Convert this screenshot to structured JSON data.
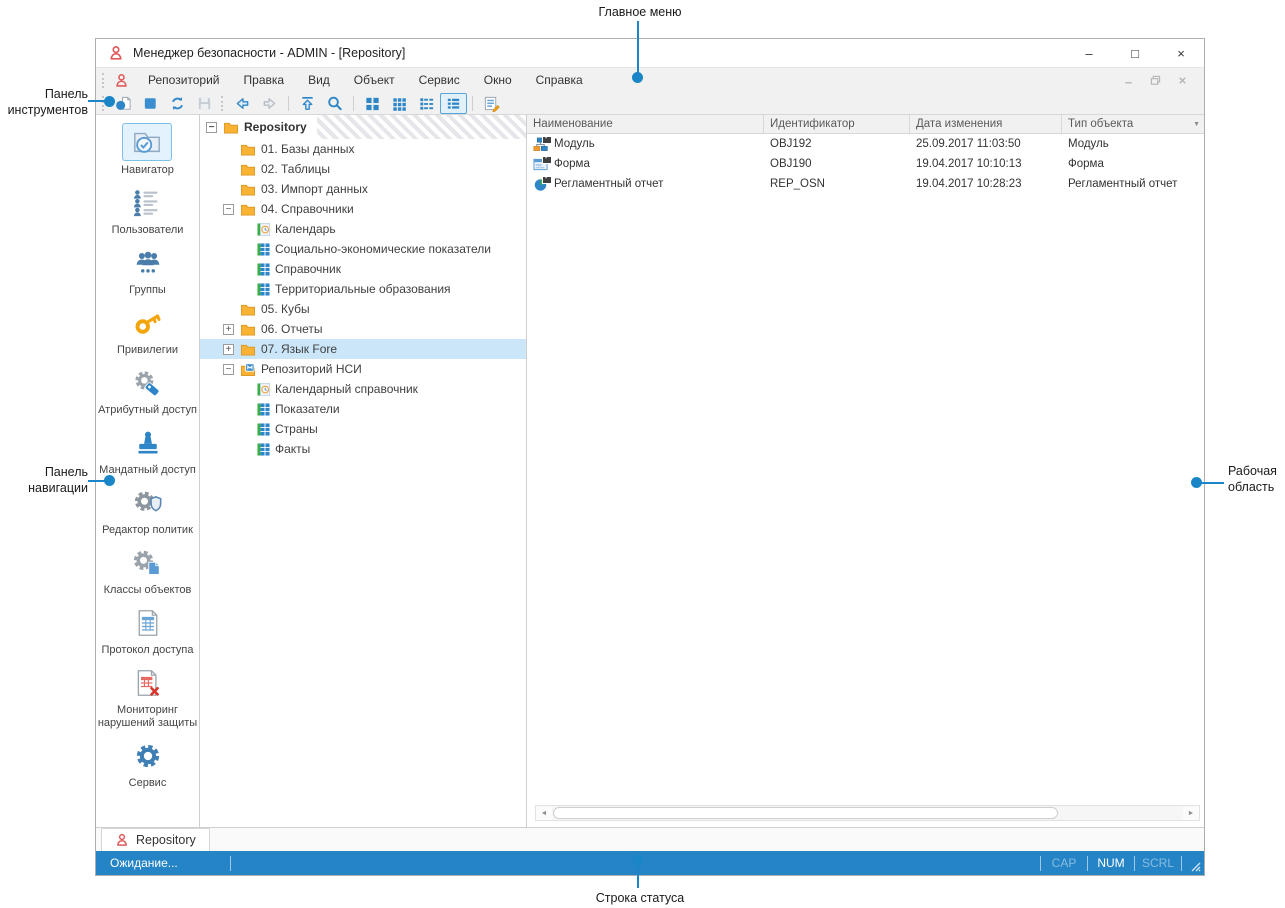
{
  "annotations": {
    "main_menu": "Главное меню",
    "toolbar_panel": "Панель инструментов",
    "navigation_panel": "Панель навигации",
    "work_area": "Рабочая область",
    "status_bar": "Строка статуса"
  },
  "window": {
    "title": "Менеджер безопасности - ADMIN - [Repository]"
  },
  "icons": {
    "minimize": "–",
    "maximize": "□",
    "close": "×",
    "filter": "▼",
    "scroll_left": "◄",
    "scroll_right": "►",
    "expander_open": "−",
    "expander_closed": "+"
  },
  "menu": {
    "items": [
      {
        "label": "Репозиторий"
      },
      {
        "label": "Правка"
      },
      {
        "label": "Вид"
      },
      {
        "label": "Объект"
      },
      {
        "label": "Сервис"
      },
      {
        "label": "Окно"
      },
      {
        "label": "Справка"
      }
    ]
  },
  "toolbar": {
    "buttons": [
      {
        "name": "create-object",
        "state": "enabled"
      },
      {
        "name": "open-object",
        "state": "enabled"
      },
      {
        "name": "refresh",
        "state": "enabled"
      },
      {
        "name": "save",
        "state": "disabled"
      },
      {
        "name": "back",
        "state": "enabled"
      },
      {
        "name": "forward",
        "state": "disabled"
      },
      {
        "name": "up-level",
        "state": "enabled"
      },
      {
        "name": "search",
        "state": "enabled"
      },
      {
        "name": "large-icons-view",
        "state": "enabled"
      },
      {
        "name": "small-icons-view",
        "state": "enabled"
      },
      {
        "name": "list-view",
        "state": "enabled"
      },
      {
        "name": "details-view",
        "state": "selected"
      },
      {
        "name": "properties",
        "state": "enabled"
      }
    ]
  },
  "navigation": {
    "items": [
      {
        "label": "Навигатор",
        "selected": true
      },
      {
        "label": "Пользователи",
        "selected": false
      },
      {
        "label": "Группы",
        "selected": false
      },
      {
        "label": "Привилегии",
        "selected": false
      },
      {
        "label": "Атрибутный доступ",
        "selected": false
      },
      {
        "label": "Мандатный доступ",
        "selected": false
      },
      {
        "label": "Редактор политик",
        "selected": false
      },
      {
        "label": "Классы объектов",
        "selected": false
      },
      {
        "label": "Протокол доступа",
        "selected": false
      },
      {
        "label": "Мониторинг нарушений защиты",
        "selected": false
      },
      {
        "label": "Сервис",
        "selected": false
      }
    ]
  },
  "tree": {
    "items": [
      {
        "label": "Repository",
        "level": 0,
        "icon": "folder",
        "expander": "minus",
        "bold": true
      },
      {
        "label": "01. Базы данных",
        "level": 1,
        "icon": "folder",
        "expander": "none"
      },
      {
        "label": "02. Таблицы",
        "level": 1,
        "icon": "folder",
        "expander": "none"
      },
      {
        "label": "03. Импорт данных",
        "level": 1,
        "icon": "folder",
        "expander": "none"
      },
      {
        "label": "04. Справочники",
        "level": 1,
        "icon": "folder",
        "expander": "minus"
      },
      {
        "label": "Календарь",
        "level": 2,
        "icon": "calendar",
        "expander": "none"
      },
      {
        "label": "Социально-экономические показатели",
        "level": 2,
        "icon": "table",
        "expander": "none"
      },
      {
        "label": "Справочник",
        "level": 2,
        "icon": "table",
        "expander": "none"
      },
      {
        "label": "Территориальные образования",
        "level": 2,
        "icon": "table",
        "expander": "none"
      },
      {
        "label": "05. Кубы",
        "level": 1,
        "icon": "folder",
        "expander": "none"
      },
      {
        "label": "06. Отчеты",
        "level": 1,
        "icon": "folder",
        "expander": "plus"
      },
      {
        "label": "07. Язык Fore",
        "level": 1,
        "icon": "folder",
        "expander": "plus",
        "selected": true
      },
      {
        "label": "Репозиторий НСИ",
        "level": 1,
        "icon": "folder-nsi",
        "expander": "minus"
      },
      {
        "label": "Календарный справочник",
        "level": 2,
        "icon": "calendar",
        "expander": "none"
      },
      {
        "label": "Показатели",
        "level": 2,
        "icon": "table",
        "expander": "none"
      },
      {
        "label": "Страны",
        "level": 2,
        "icon": "table",
        "expander": "none"
      },
      {
        "label": "Факты",
        "level": 2,
        "icon": "table",
        "expander": "none"
      }
    ]
  },
  "table": {
    "columns": [
      {
        "label": "Наименование"
      },
      {
        "label": "Идентификатор"
      },
      {
        "label": "Дата изменения"
      },
      {
        "label": "Тип объекта"
      }
    ],
    "rows": [
      {
        "name": "Модуль",
        "icon": "module-icon",
        "id": "OBJ192",
        "modified": "25.09.2017 11:03:50",
        "type": "Модуль"
      },
      {
        "name": "Форма",
        "icon": "form-icon",
        "id": "OBJ190",
        "modified": "19.04.2017 10:10:13",
        "type": "Форма"
      },
      {
        "name": "Регламентный отчет",
        "icon": "report-icon",
        "id": "REP_OSN",
        "modified": "19.04.2017 10:28:23",
        "type": "Регламентный отчет"
      }
    ]
  },
  "tabs": [
    {
      "label": "Repository",
      "active": true
    }
  ],
  "status": {
    "message": "Ожидание...",
    "keys": [
      {
        "label": "CAP",
        "active": false
      },
      {
        "label": "NUM",
        "active": true
      },
      {
        "label": "SCRL",
        "active": false
      }
    ]
  },
  "colors": {
    "accent": "#2e86c8",
    "status_bar": "#2484c6",
    "tree_selection": "#cbe6f8",
    "callout": "#1b86c7"
  }
}
